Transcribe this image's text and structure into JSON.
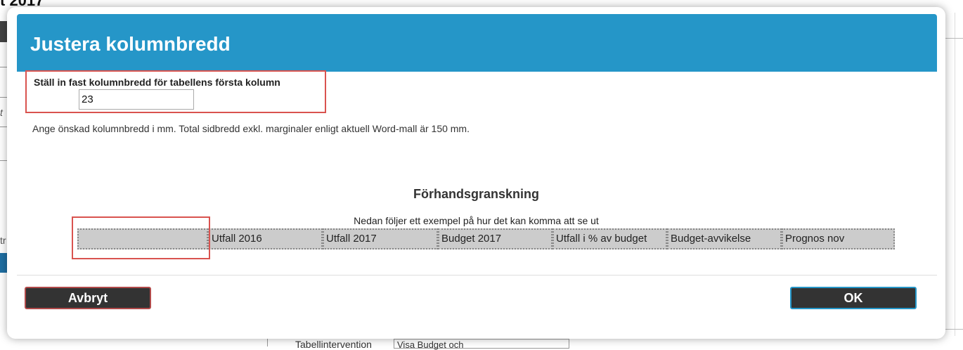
{
  "background": {
    "title_fragment": "t 2017",
    "left_fragment_1": "t",
    "left_fragment_2": "tr",
    "left_fragment_3": "ri",
    "bottom_label": "Tabellintervention",
    "bottom_select_value": "Visa Budget och"
  },
  "dialog": {
    "title": "Justera kolumnbredd",
    "input_label": "Ställ in fast kolumnbredd för tabellens första kolumn",
    "input_value": "23",
    "help_text": "Ange önskad kolumnbredd i mm. Total sidbredd exkl. marginaler enligt aktuell Word-mall är 150 mm.",
    "preview": {
      "title": "Förhandsgranskning",
      "subtitle": "Nedan följer ett exempel på hur det kan komma att se ut",
      "columns": [
        "",
        "Utfall 2016",
        "Utfall 2017",
        "Budget 2017",
        "Utfall i % av budget",
        "Budget-avvikelse",
        "Prognos nov"
      ]
    },
    "buttons": {
      "cancel": "Avbryt",
      "ok": "OK"
    }
  },
  "colors": {
    "header_bg": "#2596c8",
    "highlight_border": "#d9534f",
    "button_bg": "#333333",
    "cell_bg": "#cccccc"
  }
}
